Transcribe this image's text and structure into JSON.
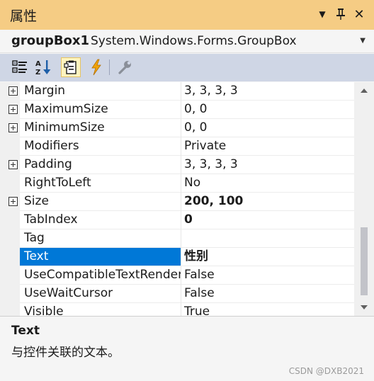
{
  "window": {
    "title": "属性",
    "dropdown_glyph": "▼",
    "pin_glyph": "📌",
    "close_glyph": "✕"
  },
  "object_selector": {
    "name": "groupBox1",
    "type": "System.Windows.Forms.GroupBox",
    "dropdown_glyph": "▼"
  },
  "toolbar": {
    "tools": [
      {
        "icon": "categorized-icon",
        "active": false
      },
      {
        "icon": "alphabetical-icon",
        "active": false
      },
      {
        "icon": "properties-icon",
        "active": true
      },
      {
        "icon": "events-lightning-icon",
        "active": false
      },
      {
        "icon": "property-pages-wrench-icon",
        "active": false
      }
    ],
    "alpha_a": "A",
    "alpha_z": "Z"
  },
  "properties": [
    {
      "name": "Margin",
      "value": "3, 3, 3, 3",
      "expandable": true,
      "bold": false
    },
    {
      "name": "MaximumSize",
      "value": "0, 0",
      "expandable": true,
      "bold": false
    },
    {
      "name": "MinimumSize",
      "value": "0, 0",
      "expandable": true,
      "bold": false
    },
    {
      "name": "Modifiers",
      "value": "Private",
      "expandable": false,
      "bold": false
    },
    {
      "name": "Padding",
      "value": "3, 3, 3, 3",
      "expandable": true,
      "bold": false
    },
    {
      "name": "RightToLeft",
      "value": "No",
      "expandable": false,
      "bold": false
    },
    {
      "name": "Size",
      "value": "200, 100",
      "expandable": true,
      "bold": true
    },
    {
      "name": "TabIndex",
      "value": "0",
      "expandable": false,
      "bold": true
    },
    {
      "name": "Tag",
      "value": "",
      "expandable": false,
      "bold": false
    },
    {
      "name": "Text",
      "value": "性别",
      "expandable": false,
      "bold": true,
      "selected": true
    },
    {
      "name": "UseCompatibleTextRendering",
      "value": "False",
      "expandable": false,
      "bold": false
    },
    {
      "name": "UseWaitCursor",
      "value": "False",
      "expandable": false,
      "bold": false
    },
    {
      "name": "Visible",
      "value": "True",
      "expandable": false,
      "bold": false
    }
  ],
  "description": {
    "title": "Text",
    "text": "与控件关联的文本。"
  },
  "watermark": "CSDN @DXB2021",
  "colors": {
    "title_bar": "#f5cc84",
    "selection": "#0078d7",
    "toolbar": "#cfd6e5",
    "lightning": "#f0a30a"
  }
}
